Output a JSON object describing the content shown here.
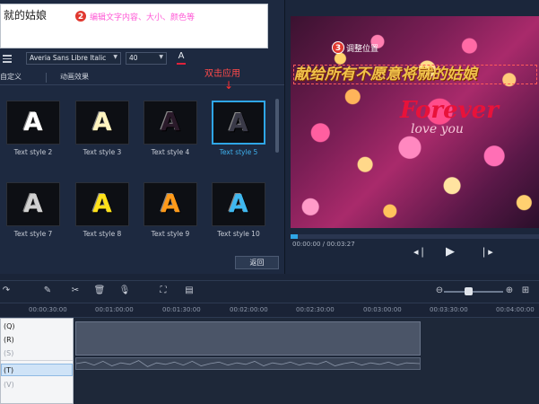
{
  "editor": {
    "text_value": "就的姑娘",
    "hint_number": "2",
    "hint_text": "编辑文字内容、大小、颜色等",
    "font_name": "Averia Sans Libre Italic",
    "font_size": "40",
    "color_glyph": "A",
    "tabs": [
      "自定义",
      "动画效果"
    ],
    "double_click_hint": "双击应用",
    "back_label": "返回"
  },
  "styles": {
    "row1": [
      {
        "label": "Text style 2",
        "letter": "A",
        "color": "#ffffff",
        "selected": false
      },
      {
        "label": "Text style 3",
        "letter": "A",
        "color": "#fff4c0",
        "selected": false
      },
      {
        "label": "Text style 4",
        "letter": "A",
        "color": "#2a1a2a",
        "selected": false
      },
      {
        "label": "Text style 5",
        "letter": "A",
        "color": "#3a3a48",
        "selected": true
      }
    ],
    "row2": [
      {
        "label": "Text style 7",
        "letter": "A",
        "color": "#d0d0d0",
        "selected": false
      },
      {
        "label": "Text style 8",
        "letter": "A",
        "color": "#ffe21a",
        "selected": false
      },
      {
        "label": "Text style 9",
        "letter": "A",
        "color": "#ff9a1a",
        "selected": false
      },
      {
        "label": "Text style 10",
        "letter": "A",
        "color": "#3fb8f0",
        "selected": false
      }
    ]
  },
  "preview": {
    "pos_number": "3",
    "pos_hint": "调整位置",
    "main_text": "献给所有不愿意将就的姑娘",
    "forever": "Forever",
    "love_you": "love you",
    "timecode": "00:00:00 / 00:03:27",
    "progress_fraction": 0.03
  },
  "timeline": {
    "ticks": [
      "00:00:30:00",
      "00:01:00:00",
      "00:01:30:00",
      "00:02:00:00",
      "00:02:30:00",
      "00:03:00:00",
      "00:03:30:00",
      "00:04:00:00"
    ],
    "zoom_fraction": 0.4
  },
  "context_menu": {
    "items": [
      "(Q)",
      "(R)",
      "(S)",
      "(T)",
      "(V)"
    ]
  },
  "colors": {
    "accent": "#2fa6e6",
    "hint_pink": "#ff5ad6",
    "hint_red": "#ff4a4a"
  }
}
